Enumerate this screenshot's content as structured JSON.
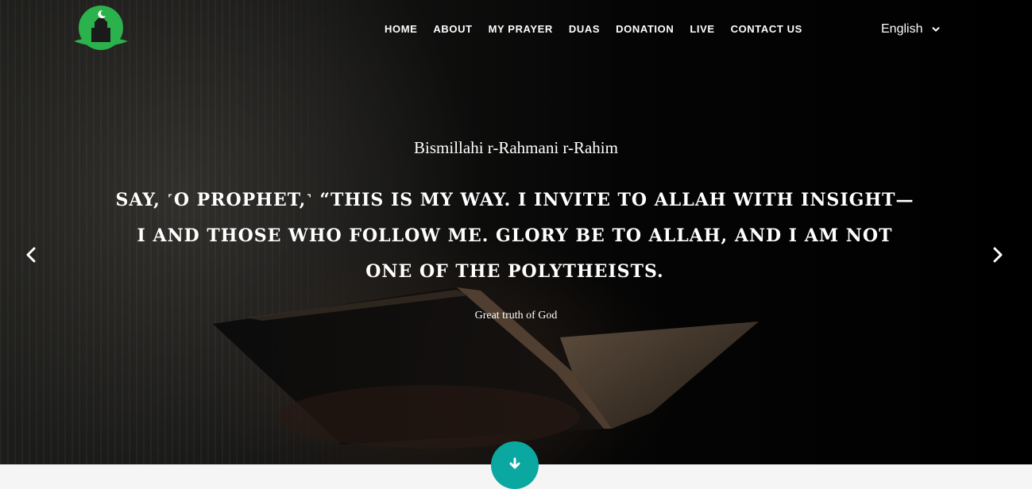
{
  "site": {
    "logo_icon": "mosque-logo-icon",
    "accent_green": "#2bb24c",
    "accent_teal": "#0aa8a0"
  },
  "nav": {
    "items": [
      {
        "label": "HOME"
      },
      {
        "label": "ABOUT"
      },
      {
        "label": "MY PRAYER"
      },
      {
        "label": "DUAS"
      },
      {
        "label": "DONATION"
      },
      {
        "label": "LIVE"
      },
      {
        "label": "CONTACT US"
      }
    ]
  },
  "language": {
    "selected": "English",
    "icon": "chevron-down-icon"
  },
  "hero": {
    "subtitle": "Bismillahi r-Rahmani r-Rahim",
    "quote": "SAY, ˹O PROPHET,˺ “THIS IS MY WAY. I INVITE TO ALLAH WITH INSIGHT—I AND THOSE WHO FOLLOW ME. GLORY BE TO ALLAH, AND I AM NOT ONE OF THE POLYTHEISTS.",
    "citation": "Great truth of God",
    "prev_icon": "chevron-left-icon",
    "next_icon": "chevron-right-icon",
    "scroll_icon": "arrow-down-icon"
  }
}
